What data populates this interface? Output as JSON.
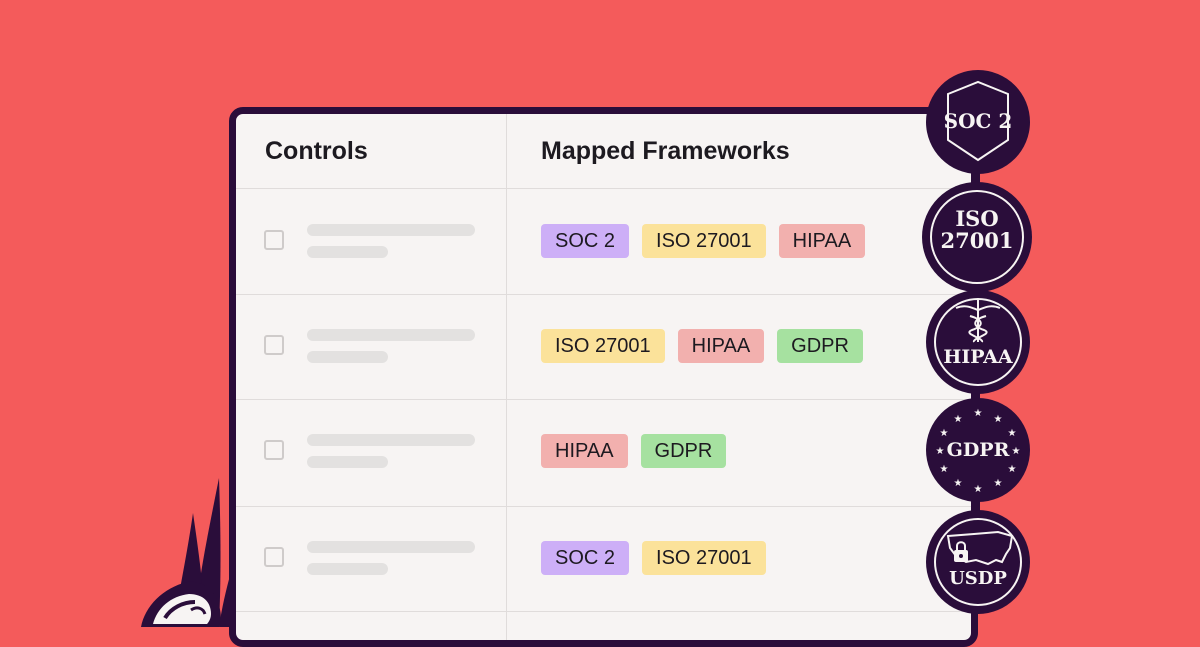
{
  "table": {
    "headers": {
      "controls": "Controls",
      "frameworks": "Mapped Frameworks"
    },
    "rows": [
      {
        "tags": [
          {
            "label": "SOC 2",
            "kind": "soc"
          },
          {
            "label": "ISO 27001",
            "kind": "iso"
          },
          {
            "label": "HIPAA",
            "kind": "hipaa"
          }
        ]
      },
      {
        "tags": [
          {
            "label": "ISO 27001",
            "kind": "iso"
          },
          {
            "label": "HIPAA",
            "kind": "hipaa"
          },
          {
            "label": "GDPR",
            "kind": "gdpr"
          }
        ]
      },
      {
        "tags": [
          {
            "label": "HIPAA",
            "kind": "hipaa"
          },
          {
            "label": "GDPR",
            "kind": "gdpr"
          }
        ]
      },
      {
        "tags": [
          {
            "label": "SOC 2",
            "kind": "soc"
          },
          {
            "label": "ISO 27001",
            "kind": "iso"
          }
        ]
      }
    ]
  },
  "badges": [
    {
      "label": "SOC 2",
      "icon": "shield-icon"
    },
    {
      "label_line1": "ISO",
      "label_line2": "27001"
    },
    {
      "label": "HIPAA",
      "icon": "caduceus-icon"
    },
    {
      "label": "GDPR",
      "icon": "eu-stars-icon"
    },
    {
      "label": "USDP",
      "icon": "us-map-lock-icon"
    }
  ],
  "colors": {
    "background": "#f45b5b",
    "dark": "#2a0d3a",
    "card": "#f7f4f3",
    "soc": "#cdaff7",
    "iso": "#fbe29a",
    "hipaa": "#f2b0ae",
    "gdpr": "#a6e1a0"
  }
}
